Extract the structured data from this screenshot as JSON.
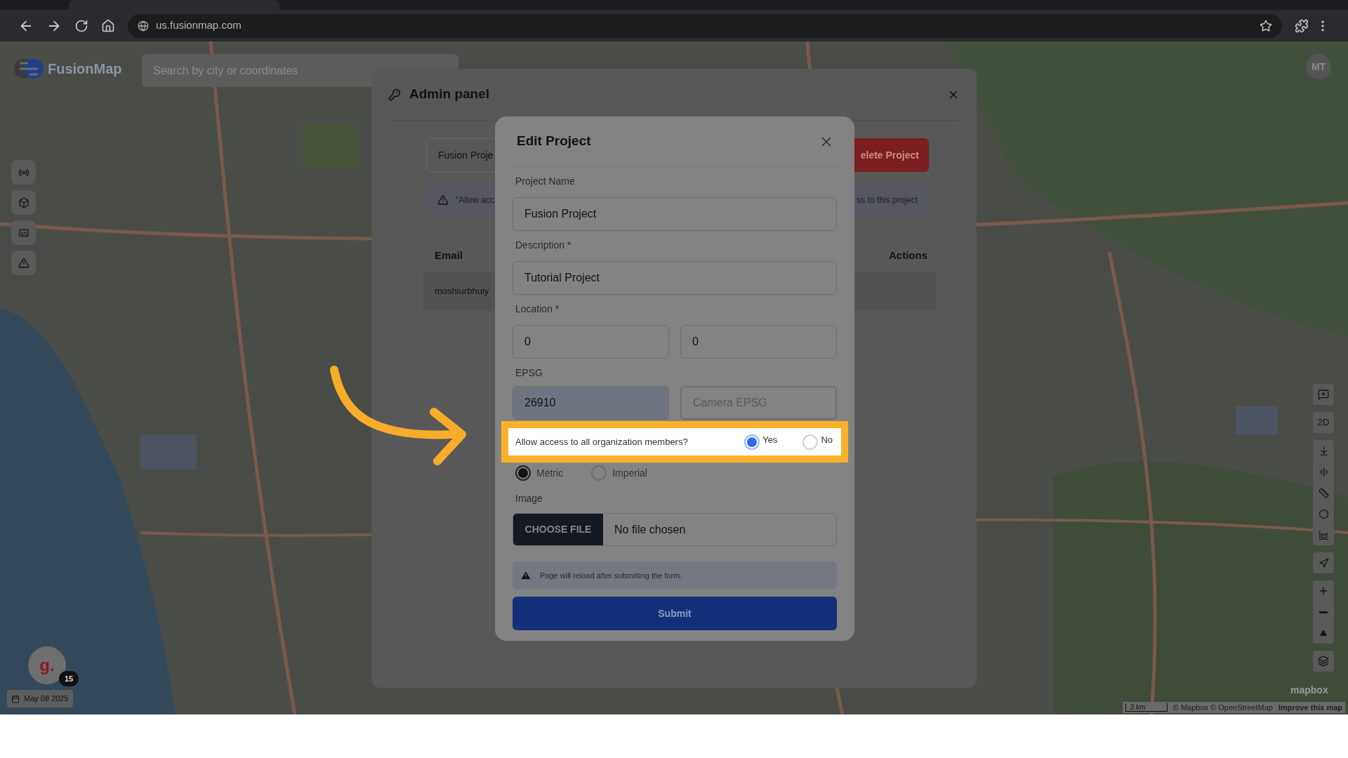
{
  "browser": {
    "address": "us.fusionmap.com"
  },
  "map": {
    "logo": "FusionMap",
    "search_placeholder": "Search by city or coordinates",
    "user_initials": "MT",
    "view_mode": "2D",
    "user_badge": {
      "letter": "g.",
      "count": "15"
    },
    "date": "May 08 2025",
    "mapbox": "mapbox",
    "scale": "3 km",
    "attribution": "© Mapbox © OpenStreetMap",
    "improve_link": "Improve this map"
  },
  "admin_panel": {
    "title": "Admin panel",
    "project_field": "Fusion Proje",
    "delete_button": "elete Project",
    "notice_left": "\"Allow acc",
    "notice_right": "ss to this project",
    "columns": [
      "Email",
      "Actions"
    ],
    "rows": [
      [
        "moshiurbhuiy"
      ]
    ]
  },
  "edit_project": {
    "title": "Edit Project",
    "fields": [
      {
        "label": "Project Name",
        "value": "Fusion Project"
      },
      {
        "label": "Description *",
        "value": "Tutorial Project"
      }
    ],
    "location": {
      "label": "Location *",
      "values": [
        "0",
        "0"
      ]
    },
    "epsg": {
      "label": "EPSG",
      "value": "26910",
      "camera_placeholder": "Camera EPSG"
    },
    "access": {
      "question": "Allow access to all organization members?",
      "highlighted": true,
      "options": [
        {
          "label": "Yes",
          "selected": true
        },
        {
          "label": "No",
          "selected": false
        }
      ]
    },
    "units": [
      {
        "label": "Metric",
        "selected": true
      },
      {
        "label": "Imperial",
        "selected": false
      }
    ],
    "image": {
      "label": "Image",
      "button": "CHOOSE FILE",
      "status": "No file chosen"
    },
    "notice": "Page will reload after submitting the form.",
    "submit": "Submit"
  }
}
